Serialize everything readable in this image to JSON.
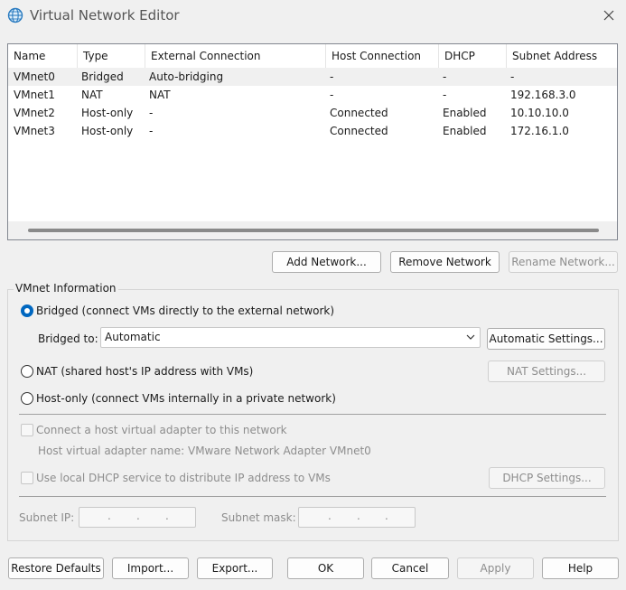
{
  "window": {
    "title": "Virtual Network Editor",
    "close_glyph": "✕"
  },
  "table": {
    "columns": [
      "Name",
      "Type",
      "External Connection",
      "Host Connection",
      "DHCP",
      "Subnet Address"
    ],
    "rows": [
      [
        "VMnet0",
        "Bridged",
        "Auto-bridging",
        "-",
        "-",
        "-"
      ],
      [
        "VMnet1",
        "NAT",
        "NAT",
        "-",
        "-",
        "192.168.3.0"
      ],
      [
        "VMnet2",
        "Host-only",
        "-",
        "Connected",
        "Enabled",
        "10.10.10.0"
      ],
      [
        "VMnet3",
        "Host-only",
        "-",
        "Connected",
        "Enabled",
        "172.16.1.0"
      ]
    ],
    "selected_row": 0
  },
  "network_buttons": {
    "add": "Add Network...",
    "remove": "Remove Network",
    "rename": "Rename Network..."
  },
  "vmnet_info": {
    "group_title": "VMnet Information",
    "bridged_label": "Bridged (connect VMs directly to the external network)",
    "bridged_to_label": "Bridged to:",
    "bridged_to_value": "Automatic",
    "automatic_settings": "Automatic Settings...",
    "nat_label": "NAT (shared host's IP address with VMs)",
    "nat_settings": "NAT Settings...",
    "hostonly_label": "Host-only (connect VMs internally in a private network)",
    "connect_adapter_label": "Connect a host virtual adapter to this network",
    "adapter_name_label": "Host virtual adapter name: VMware Network Adapter VMnet0",
    "dhcp_label": "Use local DHCP service to distribute IP address to VMs",
    "dhcp_settings": "DHCP Settings...",
    "subnet_ip_label": "Subnet IP:",
    "subnet_mask_label": "Subnet mask:",
    "ip_dot": "."
  },
  "footer": {
    "restore_defaults": "Restore Defaults",
    "import": "Import...",
    "export": "Export...",
    "ok": "OK",
    "cancel": "Cancel",
    "apply": "Apply",
    "help": "Help"
  },
  "colors": {
    "accent": "#0067c0",
    "disabled_text": "#8d8d8d"
  }
}
